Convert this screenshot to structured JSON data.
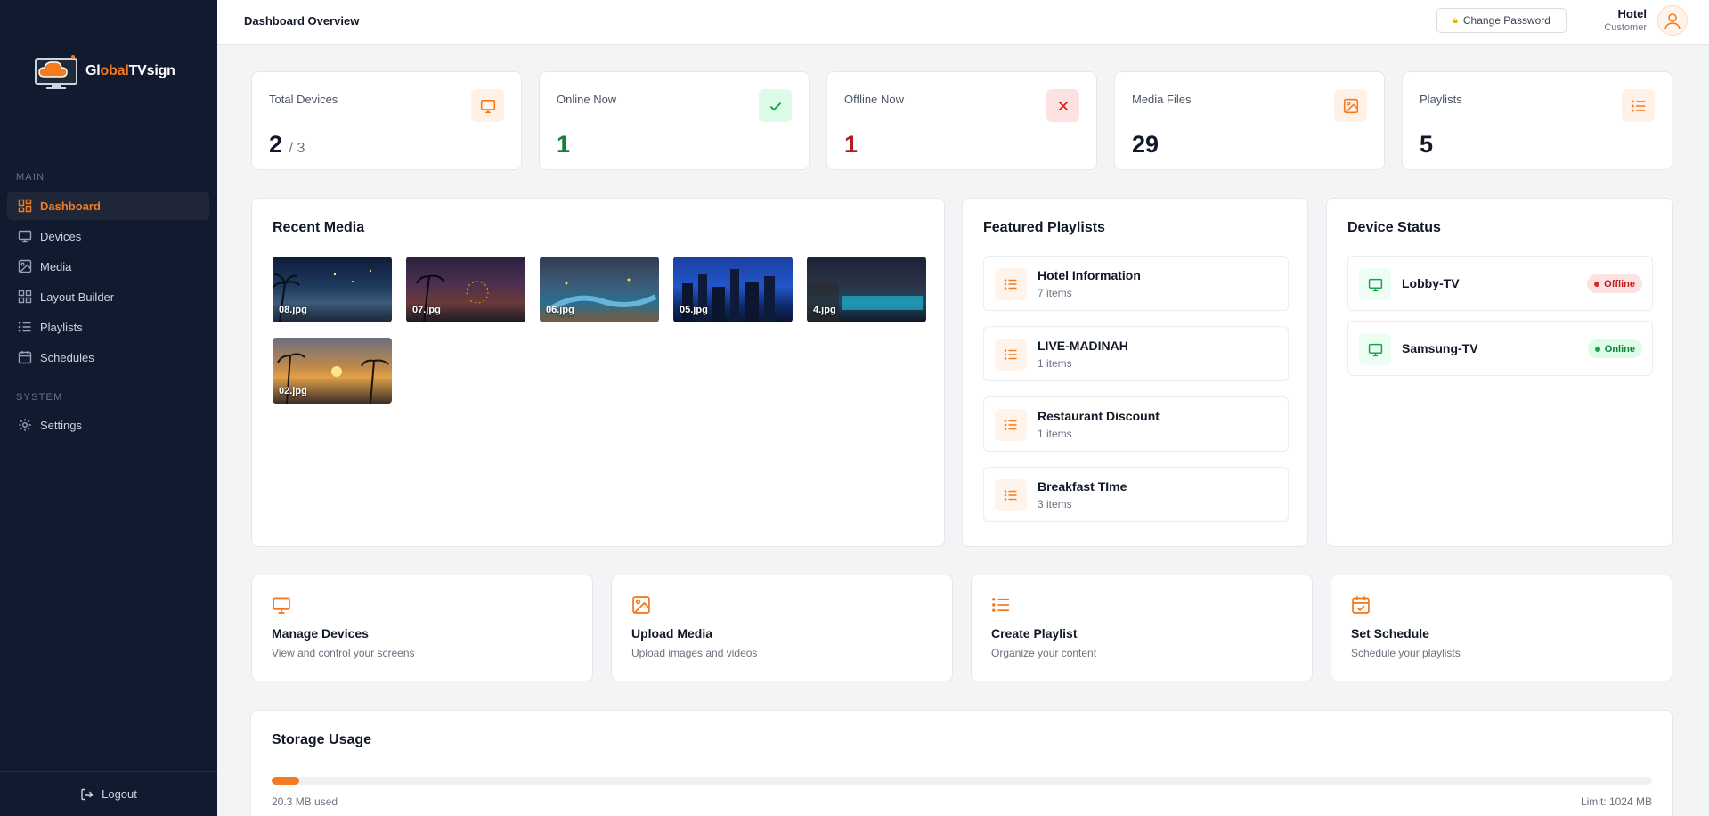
{
  "colors": {
    "accent": "#f47b20",
    "sidebar_bg": "#111a2e",
    "success": "#15803d",
    "danger": "#b91c1c"
  },
  "brand": {
    "name_prefix": "Gl",
    "name_mid": "o",
    "name_accent": "bal",
    "name_suffix": "TVsign"
  },
  "sidebar": {
    "main_section": "MAIN",
    "system_section": "SYSTEM",
    "items": [
      {
        "label": "Dashboard",
        "icon": "dashboard-icon",
        "active": true
      },
      {
        "label": "Devices",
        "icon": "monitor-icon"
      },
      {
        "label": "Media",
        "icon": "image-icon"
      },
      {
        "label": "Layout Builder",
        "icon": "grid-icon"
      },
      {
        "label": "Playlists",
        "icon": "list-icon"
      },
      {
        "label": "Schedules",
        "icon": "calendar-icon"
      },
      {
        "label": "Settings",
        "icon": "gear-icon"
      }
    ],
    "logout": "Logout"
  },
  "header": {
    "title": "Dashboard Overview",
    "change_password": "Change Password",
    "user_name": "Hotel",
    "user_role": "Customer"
  },
  "stats": [
    {
      "label": "Total Devices",
      "value": "2",
      "sub": "/ 3",
      "icon": "monitor-icon"
    },
    {
      "label": "Online Now",
      "value": "1",
      "icon": "check-icon"
    },
    {
      "label": "Offline Now",
      "value": "1",
      "icon": "close-icon"
    },
    {
      "label": "Media Files",
      "value": "29",
      "icon": "image-icon"
    },
    {
      "label": "Playlists",
      "value": "5",
      "icon": "list-icon"
    }
  ],
  "recent_media": {
    "title": "Recent Media",
    "items": [
      "08.jpg",
      "07.jpg",
      "06.jpg",
      "05.jpg",
      "4.jpg",
      "02.jpg"
    ]
  },
  "featured_playlists": {
    "title": "Featured Playlists",
    "items": [
      {
        "name": "Hotel Information",
        "count": "7 items"
      },
      {
        "name": "LIVE-MADINAH",
        "count": "1 items"
      },
      {
        "name": "Restaurant Discount",
        "count": "1 items"
      },
      {
        "name": "Breakfast TIme",
        "count": "3 items"
      }
    ]
  },
  "device_status": {
    "title": "Device Status",
    "items": [
      {
        "name": "Lobby-TV",
        "status": "Offline"
      },
      {
        "name": "Samsung-TV",
        "status": "Online"
      }
    ]
  },
  "quick_actions": [
    {
      "title": "Manage Devices",
      "desc": "View and control your screens",
      "icon": "monitor-icon"
    },
    {
      "title": "Upload Media",
      "desc": "Upload images and videos",
      "icon": "image-icon"
    },
    {
      "title": "Create Playlist",
      "desc": "Organize your content",
      "icon": "list-icon"
    },
    {
      "title": "Set Schedule",
      "desc": "Schedule your playlists",
      "icon": "calendar-check-icon"
    }
  ],
  "storage": {
    "title": "Storage Usage",
    "used": "20.3 MB used",
    "limit": "Limit: 1024 MB",
    "used_fraction": 0.0198
  }
}
